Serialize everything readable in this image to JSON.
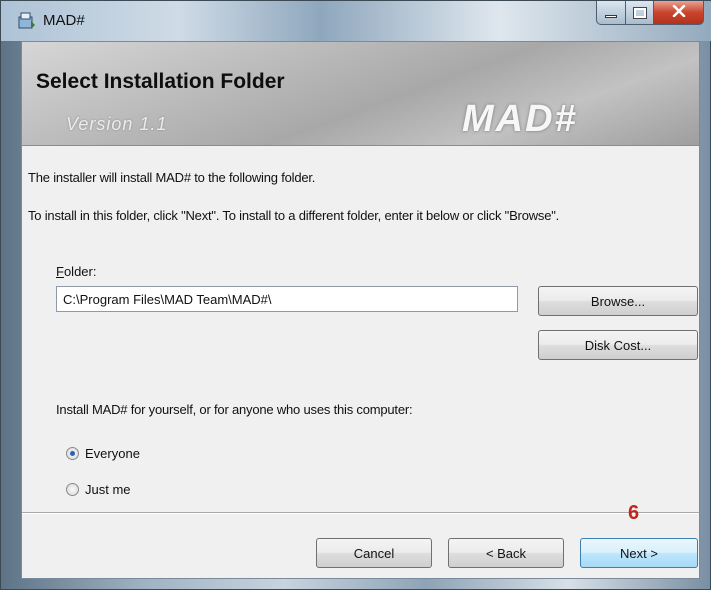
{
  "window": {
    "title": "MAD#"
  },
  "banner": {
    "title": "Select Installation Folder",
    "version": "Version 1.1",
    "logo": "MAD#"
  },
  "body": {
    "line1": "The installer will install MAD# to the following folder.",
    "line2": "To install in this folder, click \"Next\". To install to a different folder, enter it below or click \"Browse\"."
  },
  "folder": {
    "label_accel": "F",
    "label_rest": "older:",
    "value": "C:\\Program Files\\MAD Team\\MAD#\\",
    "browse_label": "Browse...",
    "disk_cost_label": "Disk Cost..."
  },
  "install_for": {
    "prompt": "Install MAD# for yourself, or for anyone who uses this computer:",
    "options": [
      {
        "label": "Everyone",
        "selected": true
      },
      {
        "label": "Just me",
        "selected": false
      }
    ]
  },
  "footer": {
    "step": "6",
    "cancel_label": "Cancel",
    "back_label": "< Back",
    "next_label": "Next >"
  },
  "colors": {
    "step_badge": "#c0261a",
    "radio_dot": "#2a62b7",
    "close_button": "#c9442c"
  },
  "icons": {
    "app": "installer-icon",
    "minimize": "minimize-icon",
    "maximize": "maximize-icon",
    "close": "close-icon"
  }
}
